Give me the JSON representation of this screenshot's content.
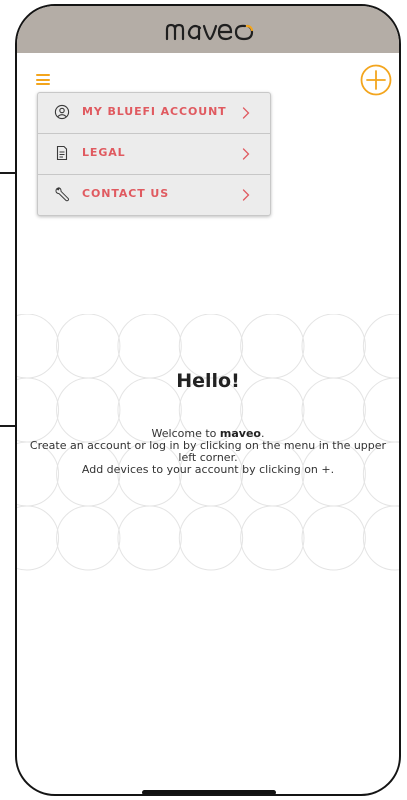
{
  "app": {
    "brand_logo": "maveo",
    "accent_color": "#f3a51d",
    "header_color": "#b4ada6",
    "menu_text_color": "#e05a60"
  },
  "toolbar": {
    "menu_icon": "hamburger-icon",
    "add_icon": "plus-circle-icon"
  },
  "menu": {
    "items": [
      {
        "label": "MY BLUEFI ACCOUNT",
        "icon": "user-circle-icon"
      },
      {
        "label": "LEGAL",
        "icon": "document-icon"
      },
      {
        "label": "CONTACT US",
        "icon": "wrench-icon"
      }
    ],
    "chevron_icon": "chevron-right-icon"
  },
  "main": {
    "greeting": "Hello!",
    "welcome_prefix": "Welcome to ",
    "welcome_brand": "maveo",
    "welcome_suffix": ".",
    "line2": "Create an account or log in by clicking on the menu in the upper left corner.",
    "line3": "Add devices to your account by clicking on +."
  }
}
